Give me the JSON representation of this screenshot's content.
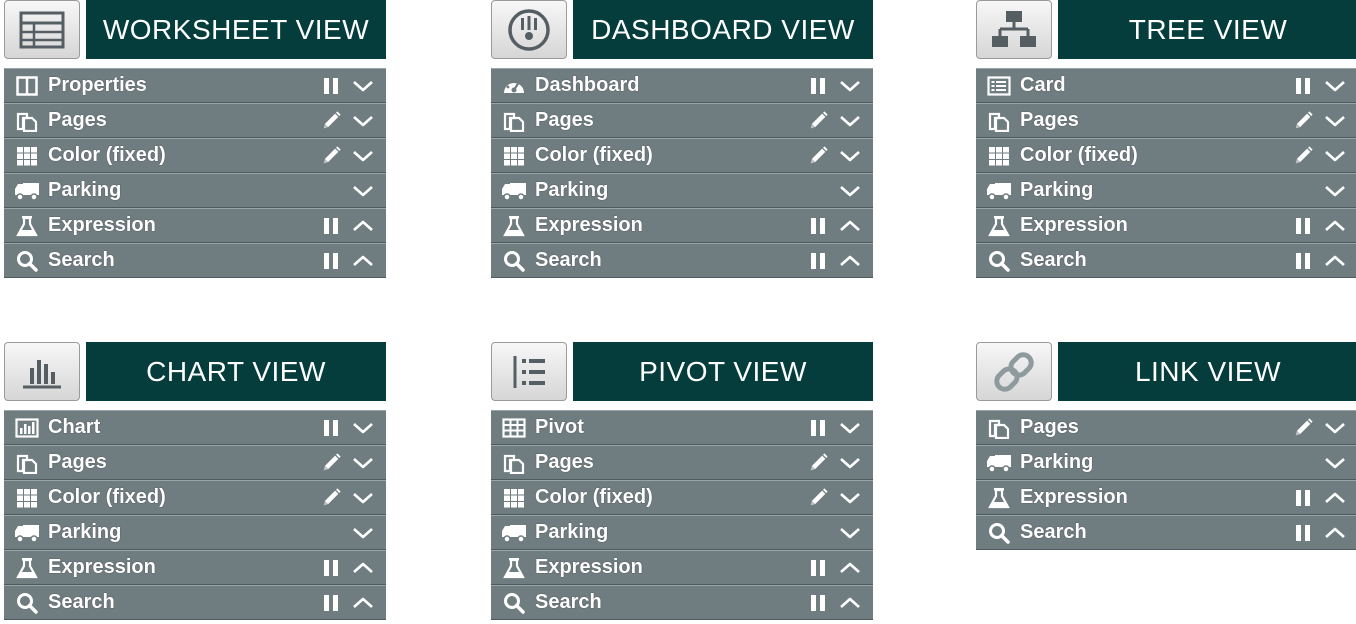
{
  "colors": {
    "header_bg": "#053c3c",
    "row_bg": "#6f7c80",
    "text": "#ffffff"
  },
  "panels": [
    {
      "title": "WORKSHEET VIEW",
      "header_icon": "worksheet-icon",
      "rows": [
        {
          "label": "Properties",
          "icon": "properties-icon",
          "controls": [
            "pause",
            "chevron-down"
          ]
        },
        {
          "label": "Pages",
          "icon": "pages-icon",
          "controls": [
            "pencil",
            "chevron-down"
          ]
        },
        {
          "label": "Color (fixed)",
          "icon": "grid-icon",
          "controls": [
            "pencil",
            "chevron-down"
          ]
        },
        {
          "label": "Parking",
          "icon": "truck-icon",
          "controls": [
            "chevron-down"
          ]
        },
        {
          "label": "Expression",
          "icon": "flask-icon",
          "controls": [
            "pause",
            "chevron-up"
          ]
        },
        {
          "label": "Search",
          "icon": "search-icon",
          "controls": [
            "pause",
            "chevron-up"
          ]
        }
      ]
    },
    {
      "title": "DASHBOARD VIEW",
      "header_icon": "dashboard-icon",
      "rows": [
        {
          "label": "Dashboard",
          "icon": "gauge-icon",
          "controls": [
            "pause",
            "chevron-down"
          ]
        },
        {
          "label": "Pages",
          "icon": "pages-icon",
          "controls": [
            "pencil",
            "chevron-down"
          ]
        },
        {
          "label": "Color (fixed)",
          "icon": "grid-icon",
          "controls": [
            "pencil",
            "chevron-down"
          ]
        },
        {
          "label": "Parking",
          "icon": "truck-icon",
          "controls": [
            "chevron-down"
          ]
        },
        {
          "label": "Expression",
          "icon": "flask-icon",
          "controls": [
            "pause",
            "chevron-up"
          ]
        },
        {
          "label": "Search",
          "icon": "search-icon",
          "controls": [
            "pause",
            "chevron-up"
          ]
        }
      ]
    },
    {
      "title": "TREE VIEW",
      "header_icon": "tree-icon",
      "rows": [
        {
          "label": "Card",
          "icon": "card-icon",
          "controls": [
            "pause",
            "chevron-down"
          ]
        },
        {
          "label": "Pages",
          "icon": "pages-icon",
          "controls": [
            "pencil",
            "chevron-down"
          ]
        },
        {
          "label": "Color (fixed)",
          "icon": "grid-icon",
          "controls": [
            "pencil",
            "chevron-down"
          ]
        },
        {
          "label": "Parking",
          "icon": "truck-icon",
          "controls": [
            "chevron-down"
          ]
        },
        {
          "label": "Expression",
          "icon": "flask-icon",
          "controls": [
            "pause",
            "chevron-up"
          ]
        },
        {
          "label": "Search",
          "icon": "search-icon",
          "controls": [
            "pause",
            "chevron-up"
          ]
        }
      ]
    },
    {
      "title": "CHART VIEW",
      "header_icon": "chart-icon",
      "rows": [
        {
          "label": "Chart",
          "icon": "bar-chart-icon",
          "controls": [
            "pause",
            "chevron-down"
          ]
        },
        {
          "label": "Pages",
          "icon": "pages-icon",
          "controls": [
            "pencil",
            "chevron-down"
          ]
        },
        {
          "label": "Color (fixed)",
          "icon": "grid-icon",
          "controls": [
            "pencil",
            "chevron-down"
          ]
        },
        {
          "label": "Parking",
          "icon": "truck-icon",
          "controls": [
            "chevron-down"
          ]
        },
        {
          "label": "Expression",
          "icon": "flask-icon",
          "controls": [
            "pause",
            "chevron-up"
          ]
        },
        {
          "label": "Search",
          "icon": "search-icon",
          "controls": [
            "pause",
            "chevron-up"
          ]
        }
      ]
    },
    {
      "title": "PIVOT VIEW",
      "header_icon": "pivot-icon",
      "rows": [
        {
          "label": "Pivot",
          "icon": "table-icon",
          "controls": [
            "pause",
            "chevron-down"
          ]
        },
        {
          "label": "Pages",
          "icon": "pages-icon",
          "controls": [
            "pencil",
            "chevron-down"
          ]
        },
        {
          "label": "Color (fixed)",
          "icon": "grid-icon",
          "controls": [
            "pencil",
            "chevron-down"
          ]
        },
        {
          "label": "Parking",
          "icon": "truck-icon",
          "controls": [
            "chevron-down"
          ]
        },
        {
          "label": "Expression",
          "icon": "flask-icon",
          "controls": [
            "pause",
            "chevron-up"
          ]
        },
        {
          "label": "Search",
          "icon": "search-icon",
          "controls": [
            "pause",
            "chevron-up"
          ]
        }
      ]
    },
    {
      "title": "LINK VIEW",
      "header_icon": "link-icon",
      "rows": [
        {
          "label": "Pages",
          "icon": "pages-icon",
          "controls": [
            "pencil",
            "chevron-down"
          ]
        },
        {
          "label": "Parking",
          "icon": "truck-icon",
          "controls": [
            "chevron-down"
          ]
        },
        {
          "label": "Expression",
          "icon": "flask-icon",
          "controls": [
            "pause",
            "chevron-up"
          ]
        },
        {
          "label": "Search",
          "icon": "search-icon",
          "controls": [
            "pause",
            "chevron-up"
          ]
        }
      ]
    }
  ]
}
